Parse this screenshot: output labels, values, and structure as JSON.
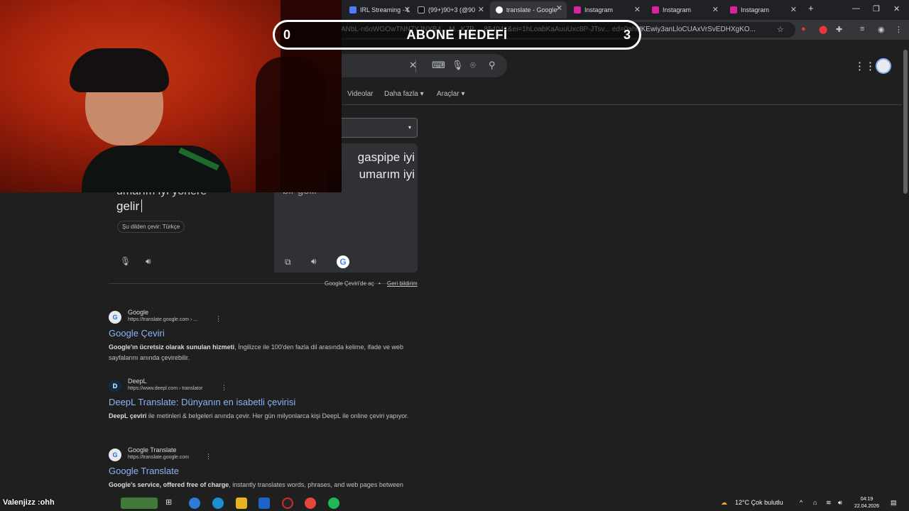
{
  "browser": {
    "tabs": [
      {
        "title": "IRL Streaming - L",
        "color": "#4f7cff"
      },
      {
        "title": "(99+)90+3 (@90",
        "color": "#111111"
      },
      {
        "title": "translate - Google",
        "color": "#ffffff",
        "active": true
      },
      {
        "title": "Instagram",
        "color": "#d6249f"
      },
      {
        "title": "Instagram",
        "color": "#d6249f"
      },
      {
        "title": "Instagram",
        "color": "#d6249f"
      }
    ],
    "new_tab": "+",
    "url": "ANbL-n6oWGOwTNN7YJNYB4... M...K7P ... 854041&ei=1hLoabKaAuuUxc8P-JTsv... ed=0ahUKEwiy3anLloCUAxVrSvEDHXgKO..."
  },
  "goal_overlay": {
    "current": "0",
    "label": "ABONE HEDEFİ",
    "target": "3"
  },
  "search": {
    "nav_links": [
      "Videolar",
      "Daha fazla ▾",
      "Araçlar ▾"
    ]
  },
  "translate": {
    "target_lang_caret": "▾",
    "output_text": "gaspipe iyi umarım iyi",
    "output_ghost": "bir gelir",
    "input_ghost": "umarım iyi yönere",
    "input_text": "gelir",
    "from_chip": "Şu dilden çevir: Türkçe",
    "footer_open": "Google Çeviri'de aç",
    "footer_feedback": "Geri bildirim"
  },
  "results": [
    {
      "site": "Google",
      "url": "https://translate.google.com › ...",
      "title": "Google Çeviri",
      "snippet_bold": "Google'ın ücretsiz olarak sunulan hizmeti",
      "snippet": ", İngilizce ile 100'den fazla dil arasında kelime, ifade ve web sayfalarını anında çevirebilir."
    },
    {
      "site": "DeepL",
      "url": "https://www.deepl.com › translator",
      "title": "DeepL Translate: Dünyanın en isabetli çevirisi",
      "snippet_bold": "DeepL çeviri",
      "snippet": " ile metinleri & belgeleri anında çevir. Her gün milyonlarca kişi DeepL ile online çeviri yapıyor."
    },
    {
      "site": "Google Translate",
      "url": "https://translate.google.com",
      "title": "Google Translate",
      "snippet_bold": "Google's service, offered free of charge",
      "snippet": ", instantly translates words, phrases, and web pages between"
    }
  ],
  "taskbar": {
    "user_overlay": "Valenjizz :ohh",
    "weather": "12°C  Çok bulutlu",
    "time": "04:19",
    "date": "22.04.2026"
  }
}
